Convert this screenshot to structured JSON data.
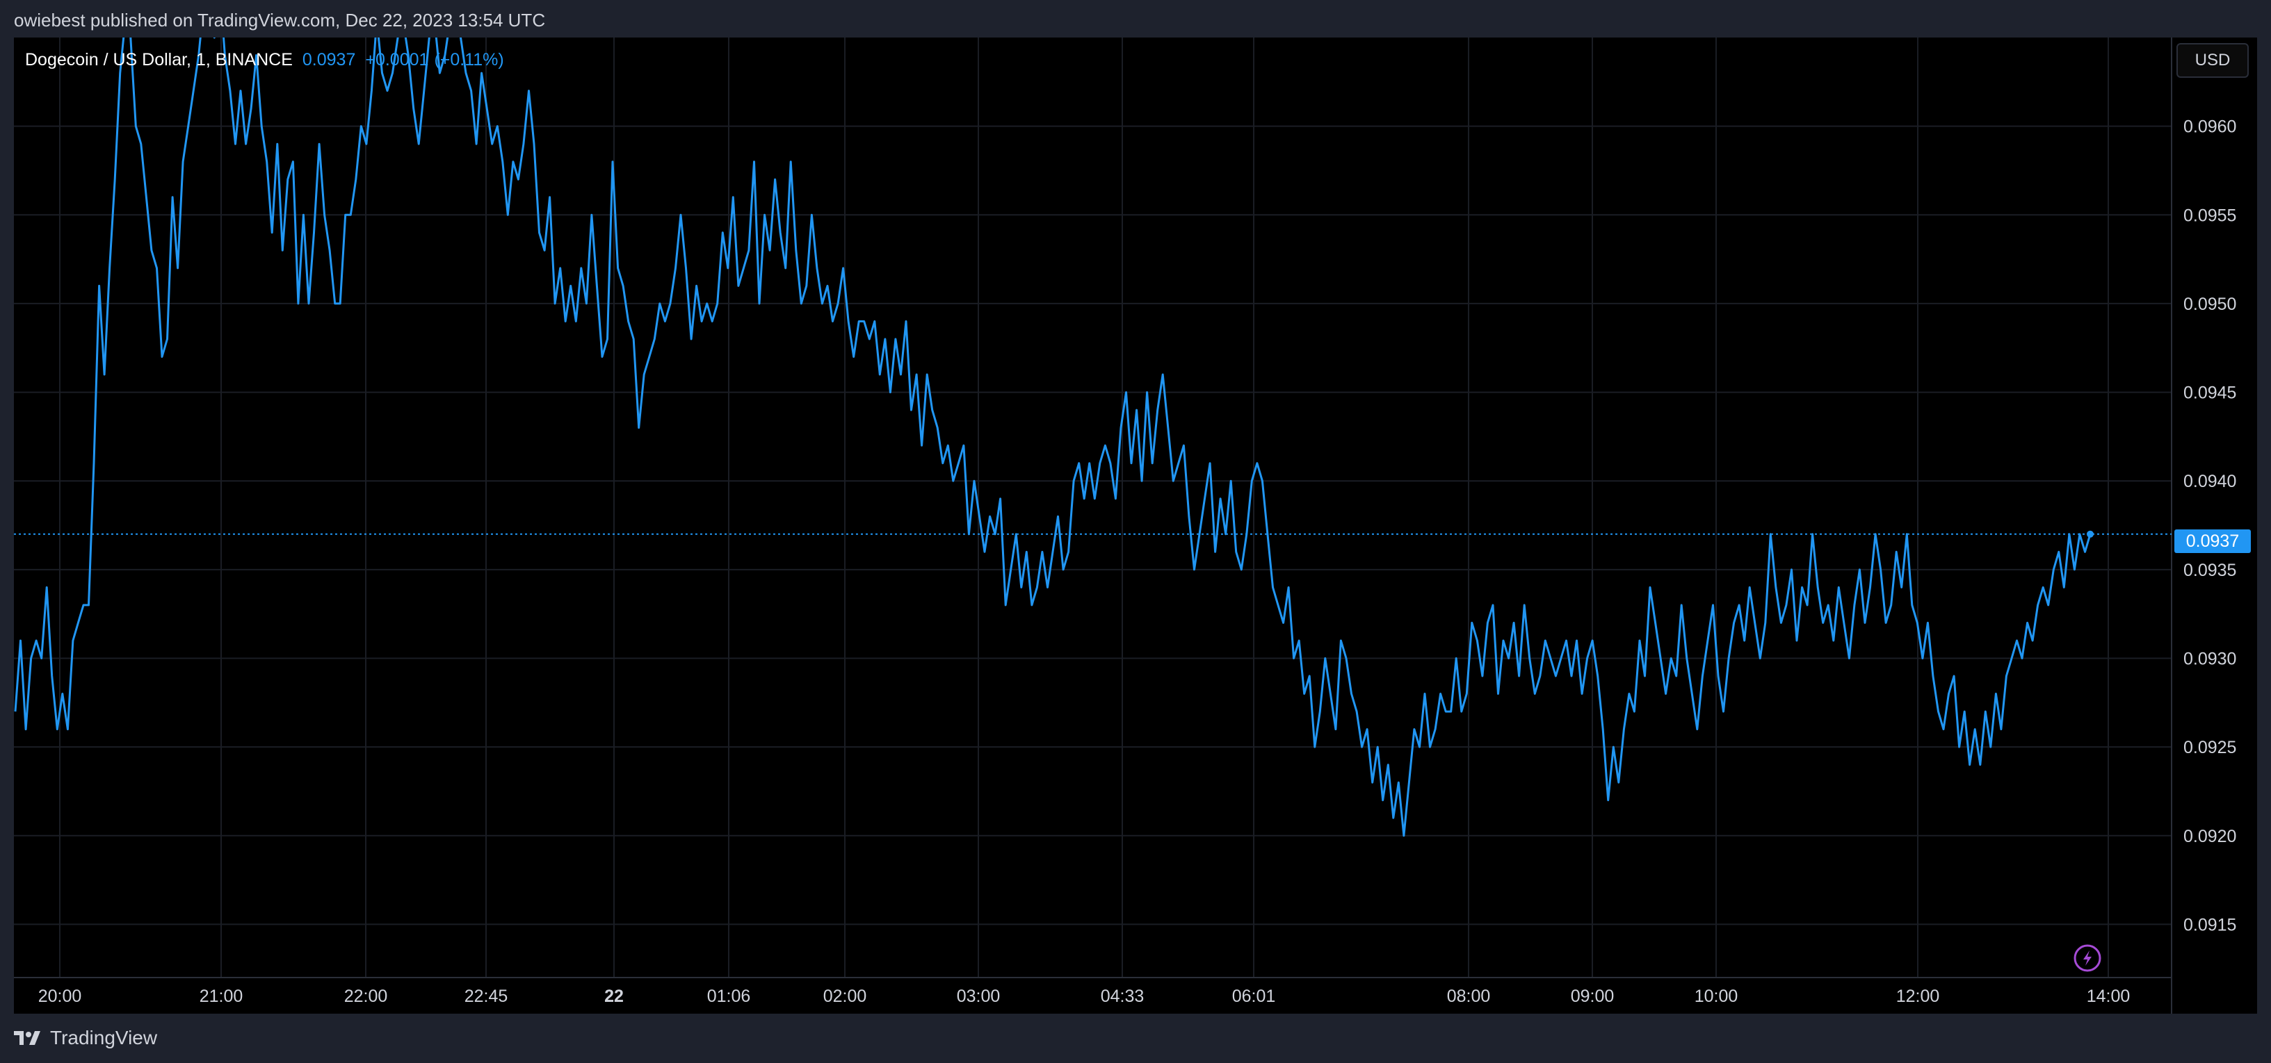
{
  "header": {
    "published_text": "owiebest published on TradingView.com, Dec 22, 2023 13:54 UTC"
  },
  "symbol_bar": {
    "title": "Dogecoin / US Dollar, 1, BINANCE",
    "price": "0.0937",
    "change": "+0.0001",
    "change_pct": "(+0.11%)"
  },
  "currency_button": {
    "label": "USD"
  },
  "last_price_label": "0.0937",
  "footer": {
    "brand": "TradingView",
    "logo_icon": "tradingview-logo-icon"
  },
  "icons": {
    "flash": "lightning-bolt-icon"
  },
  "colors": {
    "background": "#000000",
    "frame": "#1e222d",
    "line": "#2196f3",
    "grid": "#1a1d24",
    "text": "#d1d4dc"
  },
  "chart_data": {
    "type": "line",
    "title": "Dogecoin / US Dollar, 1, BINANCE",
    "xlabel": "",
    "ylabel": "",
    "ylim": [
      0.0912,
      0.0965
    ],
    "grid": true,
    "x_tick_labels": [
      "20:00",
      "21:00",
      "22:00",
      "22:45",
      "22",
      "01:06",
      "02:00",
      "03:00",
      "04:33",
      "06:01",
      "08:00",
      "09:00",
      "10:00",
      "12:00",
      "14:00"
    ],
    "y_tick_labels": [
      "0.0960",
      "0.0955",
      "0.0950",
      "0.0945",
      "0.0940",
      "0.0935",
      "0.0930",
      "0.0925",
      "0.0920",
      "0.0915"
    ],
    "last_value": 0.0937,
    "series": [
      {
        "name": "",
        "values": [
          0.0927,
          0.0931,
          0.0926,
          0.093,
          0.0931,
          0.093,
          0.0934,
          0.0929,
          0.0926,
          0.0928,
          0.0926,
          0.0931,
          0.0932,
          0.0933,
          0.0933,
          0.0941,
          0.0951,
          0.0946,
          0.0952,
          0.0957,
          0.0963,
          0.0966,
          0.0965,
          0.096,
          0.0959,
          0.0956,
          0.0953,
          0.0952,
          0.0947,
          0.0948,
          0.0956,
          0.0952,
          0.0958,
          0.096,
          0.0962,
          0.0964,
          0.0967,
          0.0966,
          0.0965,
          0.0968,
          0.0964,
          0.0962,
          0.0959,
          0.0962,
          0.0959,
          0.0961,
          0.0964,
          0.096,
          0.0958,
          0.0954,
          0.0959,
          0.0953,
          0.0957,
          0.0958,
          0.095,
          0.0955,
          0.095,
          0.0954,
          0.0959,
          0.0955,
          0.0953,
          0.095,
          0.095,
          0.0955,
          0.0955,
          0.0957,
          0.096,
          0.0959,
          0.0962,
          0.0966,
          0.0963,
          0.0962,
          0.0963,
          0.0965,
          0.0966,
          0.0964,
          0.0961,
          0.0959,
          0.0962,
          0.0965,
          0.0966,
          0.0963,
          0.0964,
          0.0966,
          0.0967,
          0.0965,
          0.0963,
          0.0962,
          0.0959,
          0.0963,
          0.0961,
          0.0959,
          0.096,
          0.0958,
          0.0955,
          0.0958,
          0.0957,
          0.0959,
          0.0962,
          0.0959,
          0.0954,
          0.0953,
          0.0956,
          0.095,
          0.0952,
          0.0949,
          0.0951,
          0.0949,
          0.0952,
          0.095,
          0.0955,
          0.0951,
          0.0947,
          0.0948,
          0.0958,
          0.0952,
          0.0951,
          0.0949,
          0.0948,
          0.0943,
          0.0946,
          0.0947,
          0.0948,
          0.095,
          0.0949,
          0.095,
          0.0952,
          0.0955,
          0.0952,
          0.0948,
          0.0951,
          0.0949,
          0.095,
          0.0949,
          0.095,
          0.0954,
          0.0952,
          0.0956,
          0.0951,
          0.0952,
          0.0953,
          0.0958,
          0.095,
          0.0955,
          0.0953,
          0.0957,
          0.0954,
          0.0952,
          0.0958,
          0.0953,
          0.095,
          0.0951,
          0.0955,
          0.0952,
          0.095,
          0.0951,
          0.0949,
          0.095,
          0.0952,
          0.0949,
          0.0947,
          0.0949,
          0.0949,
          0.0948,
          0.0949,
          0.0946,
          0.0948,
          0.0945,
          0.0948,
          0.0946,
          0.0949,
          0.0944,
          0.0946,
          0.0942,
          0.0946,
          0.0944,
          0.0943,
          0.0941,
          0.0942,
          0.094,
          0.0941,
          0.0942,
          0.0937,
          0.094,
          0.0938,
          0.0936,
          0.0938,
          0.0937,
          0.0939,
          0.0933,
          0.0935,
          0.0937,
          0.0934,
          0.0936,
          0.0933,
          0.0934,
          0.0936,
          0.0934,
          0.0936,
          0.0938,
          0.0935,
          0.0936,
          0.094,
          0.0941,
          0.0939,
          0.0941,
          0.0939,
          0.0941,
          0.0942,
          0.0941,
          0.0939,
          0.0943,
          0.0945,
          0.0941,
          0.0944,
          0.094,
          0.0945,
          0.0941,
          0.0944,
          0.0946,
          0.0943,
          0.094,
          0.0941,
          0.0942,
          0.0938,
          0.0935,
          0.0937,
          0.0939,
          0.0941,
          0.0936,
          0.0939,
          0.0937,
          0.094,
          0.0936,
          0.0935,
          0.0937,
          0.094,
          0.0941,
          0.094,
          0.0937,
          0.0934,
          0.0933,
          0.0932,
          0.0934,
          0.093,
          0.0931,
          0.0928,
          0.0929,
          0.0925,
          0.0927,
          0.093,
          0.0928,
          0.0926,
          0.0931,
          0.093,
          0.0928,
          0.0927,
          0.0925,
          0.0926,
          0.0923,
          0.0925,
          0.0922,
          0.0924,
          0.0921,
          0.0923,
          0.092,
          0.0923,
          0.0926,
          0.0925,
          0.0928,
          0.0925,
          0.0926,
          0.0928,
          0.0927,
          0.0927,
          0.093,
          0.0927,
          0.0928,
          0.0932,
          0.0931,
          0.0929,
          0.0932,
          0.0933,
          0.0928,
          0.0931,
          0.093,
          0.0932,
          0.0929,
          0.0933,
          0.093,
          0.0928,
          0.0929,
          0.0931,
          0.093,
          0.0929,
          0.093,
          0.0931,
          0.0929,
          0.0931,
          0.0928,
          0.093,
          0.0931,
          0.0929,
          0.0926,
          0.0922,
          0.0925,
          0.0923,
          0.0926,
          0.0928,
          0.0927,
          0.0931,
          0.0929,
          0.0934,
          0.0932,
          0.093,
          0.0928,
          0.093,
          0.0929,
          0.0933,
          0.093,
          0.0928,
          0.0926,
          0.0929,
          0.0931,
          0.0933,
          0.0929,
          0.0927,
          0.093,
          0.0932,
          0.0933,
          0.0931,
          0.0934,
          0.0932,
          0.093,
          0.0932,
          0.0937,
          0.0934,
          0.0932,
          0.0933,
          0.0935,
          0.0931,
          0.0934,
          0.0933,
          0.0937,
          0.0934,
          0.0932,
          0.0933,
          0.0931,
          0.0934,
          0.0932,
          0.093,
          0.0933,
          0.0935,
          0.0932,
          0.0934,
          0.0937,
          0.0935,
          0.0932,
          0.0933,
          0.0936,
          0.0934,
          0.0937,
          0.0933,
          0.0932,
          0.093,
          0.0932,
          0.0929,
          0.0927,
          0.0926,
          0.0928,
          0.0929,
          0.0925,
          0.0927,
          0.0924,
          0.0926,
          0.0924,
          0.0927,
          0.0925,
          0.0928,
          0.0926,
          0.0929,
          0.093,
          0.0931,
          0.093,
          0.0932,
          0.0931,
          0.0933,
          0.0934,
          0.0933,
          0.0935,
          0.0936,
          0.0934,
          0.0937,
          0.0935,
          0.0937,
          0.0936,
          0.0937
        ]
      }
    ]
  }
}
